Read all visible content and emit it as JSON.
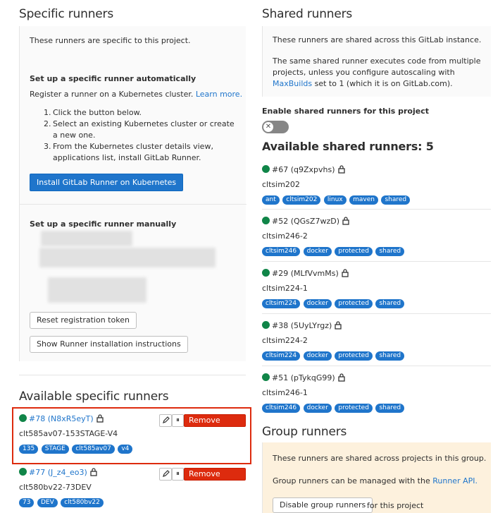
{
  "specific": {
    "title": "Specific runners",
    "intro": "These runners are specific to this project.",
    "auto_title": "Set up a specific runner automatically",
    "auto_text": "Register a runner on a Kubernetes cluster.",
    "learn_more": "Learn more.",
    "steps": [
      "Click the button below.",
      "Select an existing Kubernetes cluster or create a new one.",
      "From the Kubernetes cluster details view, applications list, install GitLab Runner."
    ],
    "install_button": "Install GitLab Runner on Kubernetes",
    "manual_title": "Set up a specific runner manually",
    "reset_button": "Reset registration token",
    "show_button": "Show Runner installation instructions",
    "available_title": "Available specific runners",
    "runners": [
      {
        "id": "#78 (N8xR5eyT)",
        "desc": "clt585av07-153STAGE-V4",
        "tags": [
          "135",
          "STAGE",
          "clt585av07",
          "v4"
        ],
        "remove": "Remove runner",
        "pause": "⏸"
      },
      {
        "id": "#77 (J_z4_eo3)",
        "desc": "clt580bv22-73DEV",
        "tags": [
          "73",
          "DEV",
          "clt580bv22"
        ],
        "remove": "Remove runner",
        "pause": "⏸"
      }
    ]
  },
  "shared": {
    "title": "Shared runners",
    "line1": "These runners are shared across this GitLab instance.",
    "line2a": "The same shared runner executes code from multiple projects, unless you configure autoscaling with",
    "maxbuilds": "MaxBuilds",
    "line2b": "set to 1 (which it is on GitLab.com).",
    "enable_label": "Enable shared runners for this project",
    "toggle_state": "off",
    "available_title": "Available shared runners: 5",
    "runners": [
      {
        "id": "#67 (q9Zxpvhs)",
        "desc": "cltsim202",
        "tags": [
          "ant",
          "cltsim202",
          "linux",
          "maven",
          "shared"
        ]
      },
      {
        "id": "#52 (QGsZ7wzD)",
        "desc": "cltsim246-2",
        "tags": [
          "cltsim246",
          "docker",
          "protected",
          "shared"
        ]
      },
      {
        "id": "#29 (MLfVvmMs)",
        "desc": "cltsim224-1",
        "tags": [
          "cltsim224",
          "docker",
          "protected",
          "shared"
        ]
      },
      {
        "id": "#38 (5UyLYrgz)",
        "desc": "cltsim224-2",
        "tags": [
          "cltsim224",
          "docker",
          "protected",
          "shared"
        ]
      },
      {
        "id": "#51 (pTykqG99)",
        "desc": "cltsim246-1",
        "tags": [
          "cltsim246",
          "docker",
          "protected",
          "shared"
        ]
      }
    ]
  },
  "group": {
    "title": "Group runners",
    "line1": "These runners are shared across projects in this group.",
    "line2": "Group runners can be managed with the",
    "api_link": "Runner API.",
    "disable_button": "Disable group runners",
    "for_project": "for this project"
  },
  "colors": {
    "accent": "#1f75cb",
    "danger": "#dd2b0e",
    "online": "#108548"
  }
}
